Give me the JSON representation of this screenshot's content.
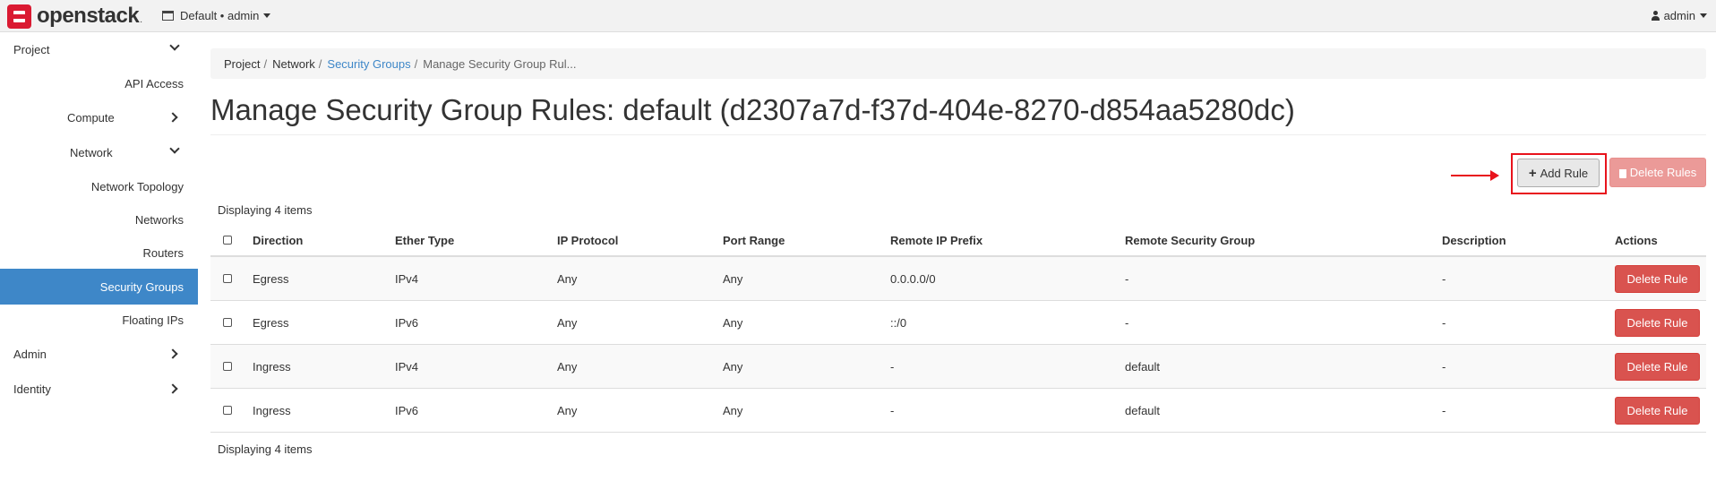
{
  "navbar": {
    "brand": "openstack",
    "project_switcher": "Default • admin",
    "user": "admin"
  },
  "sidebar": {
    "project": "Project",
    "api_access": "API Access",
    "compute": "Compute",
    "network": "Network",
    "network_topology": "Network Topology",
    "networks": "Networks",
    "routers": "Routers",
    "security_groups": "Security Groups",
    "floating_ips": "Floating IPs",
    "admin": "Admin",
    "identity": "Identity"
  },
  "breadcrumb": {
    "project": "Project",
    "network": "Network",
    "security_groups": "Security Groups",
    "current": "Manage Security Group Rul..."
  },
  "page_title": "Manage Security Group Rules: default (d2307a7d-f37d-404e-8270-d854aa5280dc)",
  "actions": {
    "add_rule": "Add Rule",
    "delete_rules": "Delete Rules"
  },
  "count_text": "Displaying 4 items",
  "table": {
    "headers": {
      "direction": "Direction",
      "ether_type": "Ether Type",
      "ip_protocol": "IP Protocol",
      "port_range": "Port Range",
      "remote_ip_prefix": "Remote IP Prefix",
      "remote_security_group": "Remote Security Group",
      "description": "Description",
      "actions": "Actions"
    },
    "rows": [
      {
        "direction": "Egress",
        "ether_type": "IPv4",
        "ip_protocol": "Any",
        "port_range": "Any",
        "remote_ip_prefix": "0.0.0.0/0",
        "remote_security_group": "-",
        "description": "-",
        "action": "Delete Rule"
      },
      {
        "direction": "Egress",
        "ether_type": "IPv6",
        "ip_protocol": "Any",
        "port_range": "Any",
        "remote_ip_prefix": "::/0",
        "remote_security_group": "-",
        "description": "-",
        "action": "Delete Rule"
      },
      {
        "direction": "Ingress",
        "ether_type": "IPv4",
        "ip_protocol": "Any",
        "port_range": "Any",
        "remote_ip_prefix": "-",
        "remote_security_group": "default",
        "description": "-",
        "action": "Delete Rule"
      },
      {
        "direction": "Ingress",
        "ether_type": "IPv6",
        "ip_protocol": "Any",
        "port_range": "Any",
        "remote_ip_prefix": "-",
        "remote_security_group": "default",
        "description": "-",
        "action": "Delete Rule"
      }
    ]
  },
  "colors": {
    "active_nav": "#3e87c8",
    "danger": "#d9534f",
    "annotation": "#e8131c"
  }
}
